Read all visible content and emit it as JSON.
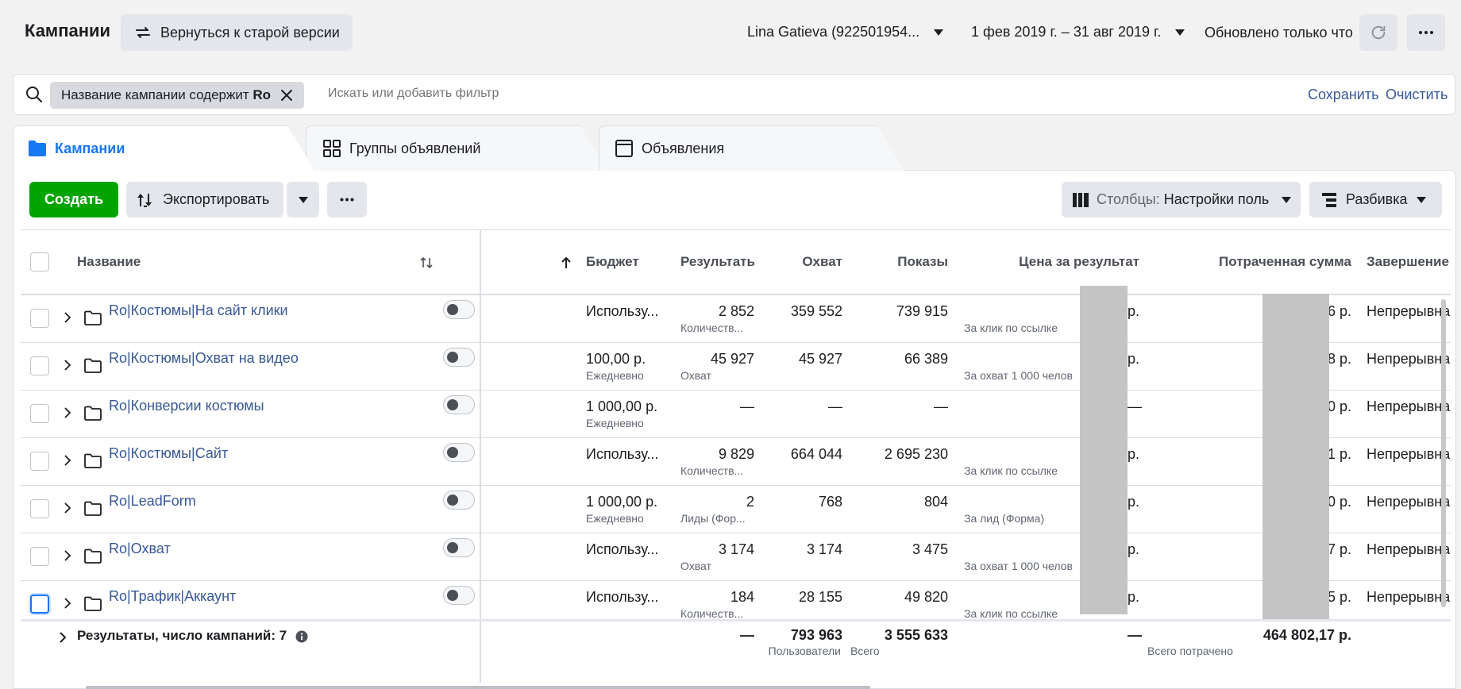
{
  "header": {
    "title": "Кампании",
    "old_version_label": "Вернуться к старой версии",
    "account": "Lina Gatieva (922501954...",
    "date_range": "1 фев 2019 г. – 31 авг 2019 г.",
    "updated": "Обновлено только что"
  },
  "filter": {
    "chip_prefix": "Название кампании содержит",
    "chip_value": "Ro",
    "placeholder": "Искать или добавить фильтр",
    "save_label": "Сохранить",
    "clear_label": "Очистить"
  },
  "tabs": [
    {
      "label": "Кампании"
    },
    {
      "label": "Группы объявлений"
    },
    {
      "label": "Объявления"
    }
  ],
  "toolbar": {
    "create_label": "Создать",
    "export_label": "Экспортировать",
    "columns_prefix": "Столбцы:",
    "columns_value": "Настройки поль",
    "breakdown_label": "Разбивка"
  },
  "table": {
    "headers": {
      "name": "Название",
      "budget": "Бюджет",
      "results": "Результать",
      "reach": "Охват",
      "impressions": "Показы",
      "cost_per_result": "Цена за результат",
      "amount_spent": "Потраченная сумма",
      "ends": "Завершение"
    },
    "rows": [
      {
        "name": "Ro|Костюмы|На сайт клики",
        "budget": "Использу...",
        "budget_sub": "",
        "results": "2 852",
        "results_sub": "Количеств...",
        "reach": "359 552",
        "impressions": "739 915",
        "cpr": "р.",
        "cpr_sub": "За клик по ссылке",
        "spent": "6 р.",
        "ends": "Непрерывна"
      },
      {
        "name": "Ro|Костюмы|Охват на видео",
        "budget": "100,00 р.",
        "budget_sub": "Ежедневно",
        "results": "45 927",
        "results_sub": "Охват",
        "reach": "45 927",
        "impressions": "66 389",
        "cpr": "р.",
        "cpr_sub": "За охват 1 000 челов",
        "spent": "8 р.",
        "ends": "Непрерывна"
      },
      {
        "name": "Ro|Конверсии костюмы",
        "budget": "1 000,00 р.",
        "budget_sub": "Ежедневно",
        "results": "—",
        "results_sub": "",
        "reach": "—",
        "impressions": "—",
        "cpr": "—",
        "cpr_sub": "",
        "spent": "0 р.",
        "ends": "Непрерывна"
      },
      {
        "name": "Ro|Костюмы|Сайт",
        "budget": "Использу...",
        "budget_sub": "",
        "results": "9 829",
        "results_sub": "Количеств...",
        "reach": "664 044",
        "impressions": "2 695 230",
        "cpr": "р.",
        "cpr_sub": "За клик по ссылке",
        "spent": "1 р.",
        "ends": "Непрерывна"
      },
      {
        "name": "Ro|LeadForm",
        "budget": "1 000,00 р.",
        "budget_sub": "Ежедневно",
        "results": "2",
        "results_sub": "Лиды (Фор...",
        "reach": "768",
        "impressions": "804",
        "cpr": "р.",
        "cpr_sub": "За лид (Форма)",
        "spent": "0 р.",
        "ends": "Непрерывна"
      },
      {
        "name": "Ro|Охват",
        "budget": "Использу...",
        "budget_sub": "",
        "results": "3 174",
        "results_sub": "Охват",
        "reach": "3 174",
        "impressions": "3 475",
        "cpr": "р.",
        "cpr_sub": "За охват 1 000 челов",
        "spent": "7 р.",
        "ends": "Непрерывна"
      },
      {
        "name": "Ro|Трафик|Аккаунт",
        "budget": "Использу...",
        "budget_sub": "",
        "results": "184",
        "results_sub": "Количеств...",
        "reach": "28 155",
        "impressions": "49 820",
        "cpr": "р.",
        "cpr_sub": "За клик по ссылке",
        "spent": "5 р.",
        "ends": "Непрерывна"
      }
    ],
    "totals": {
      "label": "Результаты, число кампаний: 7",
      "results": "—",
      "reach": "793 963",
      "reach_sub": "Пользователи",
      "impressions": "3 555 633",
      "impressions_sub": "Всего",
      "cpr": "—",
      "spent": "464 802,17 р.",
      "spent_sub": "Всего потрачено"
    }
  }
}
